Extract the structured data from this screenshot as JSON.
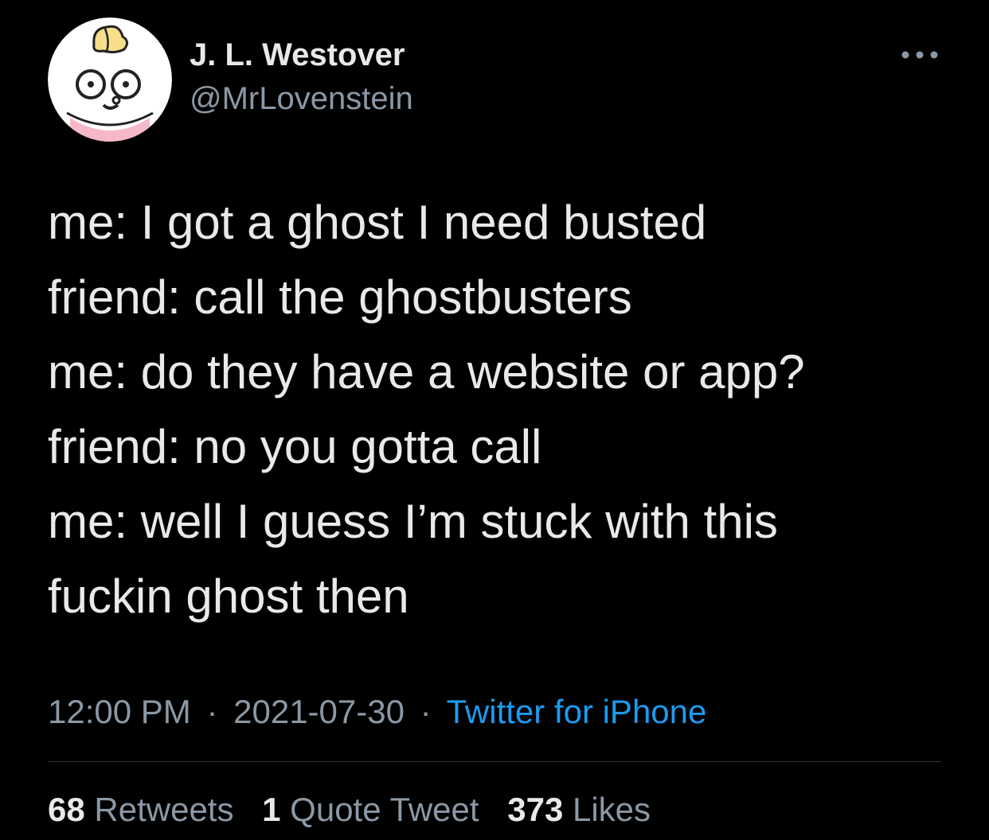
{
  "author": {
    "display_name": "J. L. Westover",
    "handle": "@MrLovenstein",
    "avatar_icon": "cartoon-avatar-icon"
  },
  "more_icon": "more-horizontal-icon",
  "tweet": {
    "lines": [
      "me: I got a ghost I need busted",
      "friend: call the ghostbusters",
      "me: do they have a website or app?",
      "friend: no you gotta call",
      "me: well I guess I’m stuck with this",
      "fuckin ghost then"
    ]
  },
  "meta": {
    "time": "12:00 PM",
    "separator": "·",
    "date": "2021-07-30",
    "source": "Twitter for iPhone"
  },
  "stats": {
    "retweets_count": "68",
    "retweets_label": "Retweets",
    "quotes_count": "1",
    "quotes_label": "Quote Tweet",
    "likes_count": "373",
    "likes_label": "Likes"
  },
  "colors": {
    "background": "#000000",
    "primary_text": "#e7e9ea",
    "secondary_text": "#8b98a5",
    "link": "#1d9bf0",
    "divider": "#2f3336"
  }
}
